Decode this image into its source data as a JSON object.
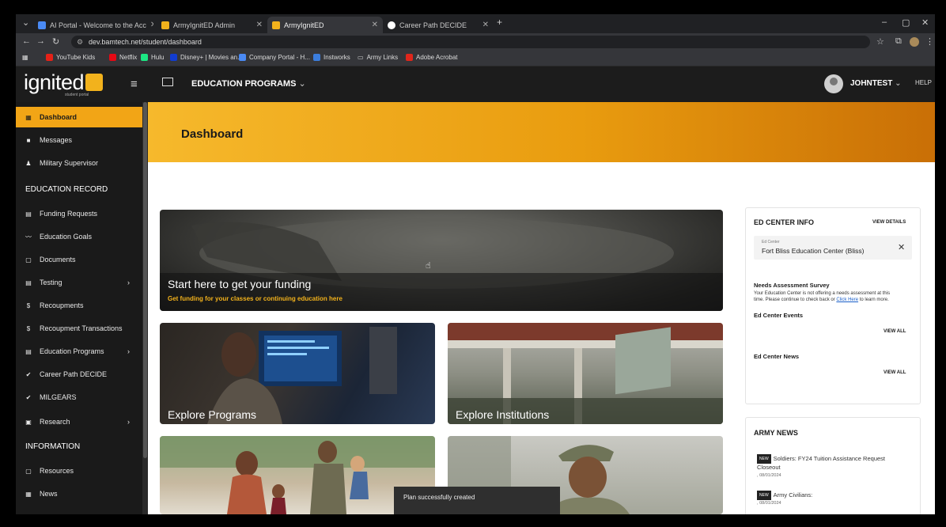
{
  "browser": {
    "tabs": [
      {
        "label": "AI Portal - Welcome to the Acc",
        "close": "✕",
        "active": false,
        "color": "#4a8af4"
      },
      {
        "label": "ArmyIgnitED Admin",
        "close": "✕",
        "active": false,
        "color": "#f2b21c"
      },
      {
        "label": "ArmyIgnitED",
        "close": "✕",
        "active": true,
        "color": "#f2b21c"
      },
      {
        "label": "Career Path DECIDE",
        "close": "✕",
        "active": false,
        "color": "#ffffff"
      }
    ],
    "new_tab": "+",
    "url": "dev.bamtech.net/student/dashboard",
    "bookmarks": [
      {
        "label": "YouTube Kids",
        "color": "#e62117"
      },
      {
        "label": "Netflix",
        "color": "#e50914"
      },
      {
        "label": "Hulu",
        "color": "#1ce783"
      },
      {
        "label": "Disney+ | Movies an...",
        "color": "#113ccf"
      },
      {
        "label": "Company Portal - H...",
        "color": "#4a8af4"
      },
      {
        "label": "Instworks",
        "color": "#3b7ddd"
      },
      {
        "label": "Army Links",
        "color": "#888888"
      },
      {
        "label": "Adobe Acrobat",
        "color": "#e0261b"
      }
    ]
  },
  "header": {
    "logo": "ignited",
    "logo_sub": "student portal",
    "menu_label": "EDUCATION PROGRAMS",
    "user_name": "JOHNTEST",
    "help": "HELP"
  },
  "sidebar": {
    "items": [
      {
        "label": "Dashboard",
        "icon": "▦",
        "active": true
      },
      {
        "label": "Messages",
        "icon": "■"
      },
      {
        "label": "Military Supervisor",
        "icon": "♟"
      }
    ],
    "section_education": "EDUCATION RECORD",
    "education_items": [
      {
        "label": "Funding Requests",
        "icon": "▤"
      },
      {
        "label": "Education Goals",
        "icon": "〰"
      },
      {
        "label": "Documents",
        "icon": "▢"
      },
      {
        "label": "Testing",
        "icon": "▤",
        "chev": "›"
      },
      {
        "label": "Recoupments",
        "icon": "$"
      },
      {
        "label": "Recoupment Transactions",
        "icon": "$"
      },
      {
        "label": "Education Programs",
        "icon": "▤",
        "chev": "›"
      },
      {
        "label": "Career Path DECIDE",
        "icon": "✔"
      },
      {
        "label": "MILGEARS",
        "icon": "✔"
      },
      {
        "label": "Research",
        "icon": "▣",
        "chev": "›"
      }
    ],
    "section_information": "INFORMATION",
    "information_items": [
      {
        "label": "Resources",
        "icon": "▢"
      },
      {
        "label": "News",
        "icon": "▦"
      }
    ]
  },
  "main": {
    "page_title": "Dashboard",
    "hero": {
      "title": "Start here to get your funding",
      "subtitle": "Get funding for your classes or continuing education here"
    },
    "cards": [
      {
        "title": "Explore Programs"
      },
      {
        "title": "Explore Institutions"
      }
    ]
  },
  "ed_center": {
    "heading": "ED CENTER INFO",
    "view_details": "VIEW DETAILS",
    "field_label": "Ed Center",
    "field_value": "Fort Bliss Education Center (Bliss)",
    "needs_heading": "Needs Assessment Survey",
    "needs_text_1": "Your Education Center is not offering a needs assessment at this",
    "needs_text_2": "time. Please continue to check back or",
    "needs_link": "Click Here",
    "needs_text_3": "to learn more.",
    "events_heading": "Ed Center Events",
    "events_view_all": "VIEW ALL",
    "news_heading": "Ed Center News",
    "news_view_all": "VIEW ALL"
  },
  "army_news": {
    "heading": "ARMY NEWS",
    "badge": "NEW",
    "items": [
      {
        "title_1": "Soldiers: FY24 Tuition Assistance Request",
        "title_2": "Closeout",
        "date": "08/01/2024"
      },
      {
        "title_1": "Army Civilians:",
        "title_2": "",
        "date": "08/01/2024"
      }
    ]
  },
  "toast": "Plan successfully created",
  "colors": {
    "accent": "#f2a516",
    "sidebar_bg": "#1a1a1a",
    "header_bg": "#1c1c1c"
  }
}
